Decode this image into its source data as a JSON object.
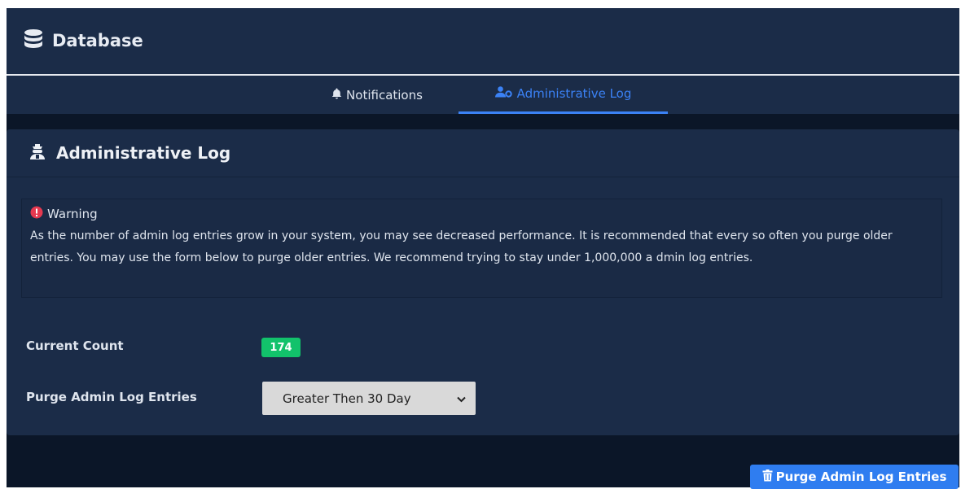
{
  "header": {
    "title": "Database",
    "icon": "database-icon"
  },
  "tabs": [
    {
      "label": "Notifications",
      "icon": "bell-icon",
      "active": false
    },
    {
      "label": "Administrative Log",
      "icon": "user-cog-icon",
      "active": true
    }
  ],
  "card": {
    "title": "Administrative Log",
    "icon": "admin-icon",
    "warning": {
      "title": "Warning",
      "text": "As the number of admin log entries grow in your system, you may see decreased performance. It is recommended that every so often you purge older entries. You may use the form below to purge older entries. We recommend trying to stay under 1,000,000 a dmin log entries."
    },
    "current_count_label": "Current Count",
    "current_count_value": "174",
    "purge_label": "Purge Admin Log Entries",
    "purge_select_value": "Greater Then 30 Day"
  },
  "purge_button_label": "Purge Admin Log Entries",
  "colors": {
    "accent": "#3b82f6",
    "panel": "#1b2c48",
    "background": "#0b1628",
    "badge": "#12c26b",
    "warning_icon": "#e53950"
  }
}
